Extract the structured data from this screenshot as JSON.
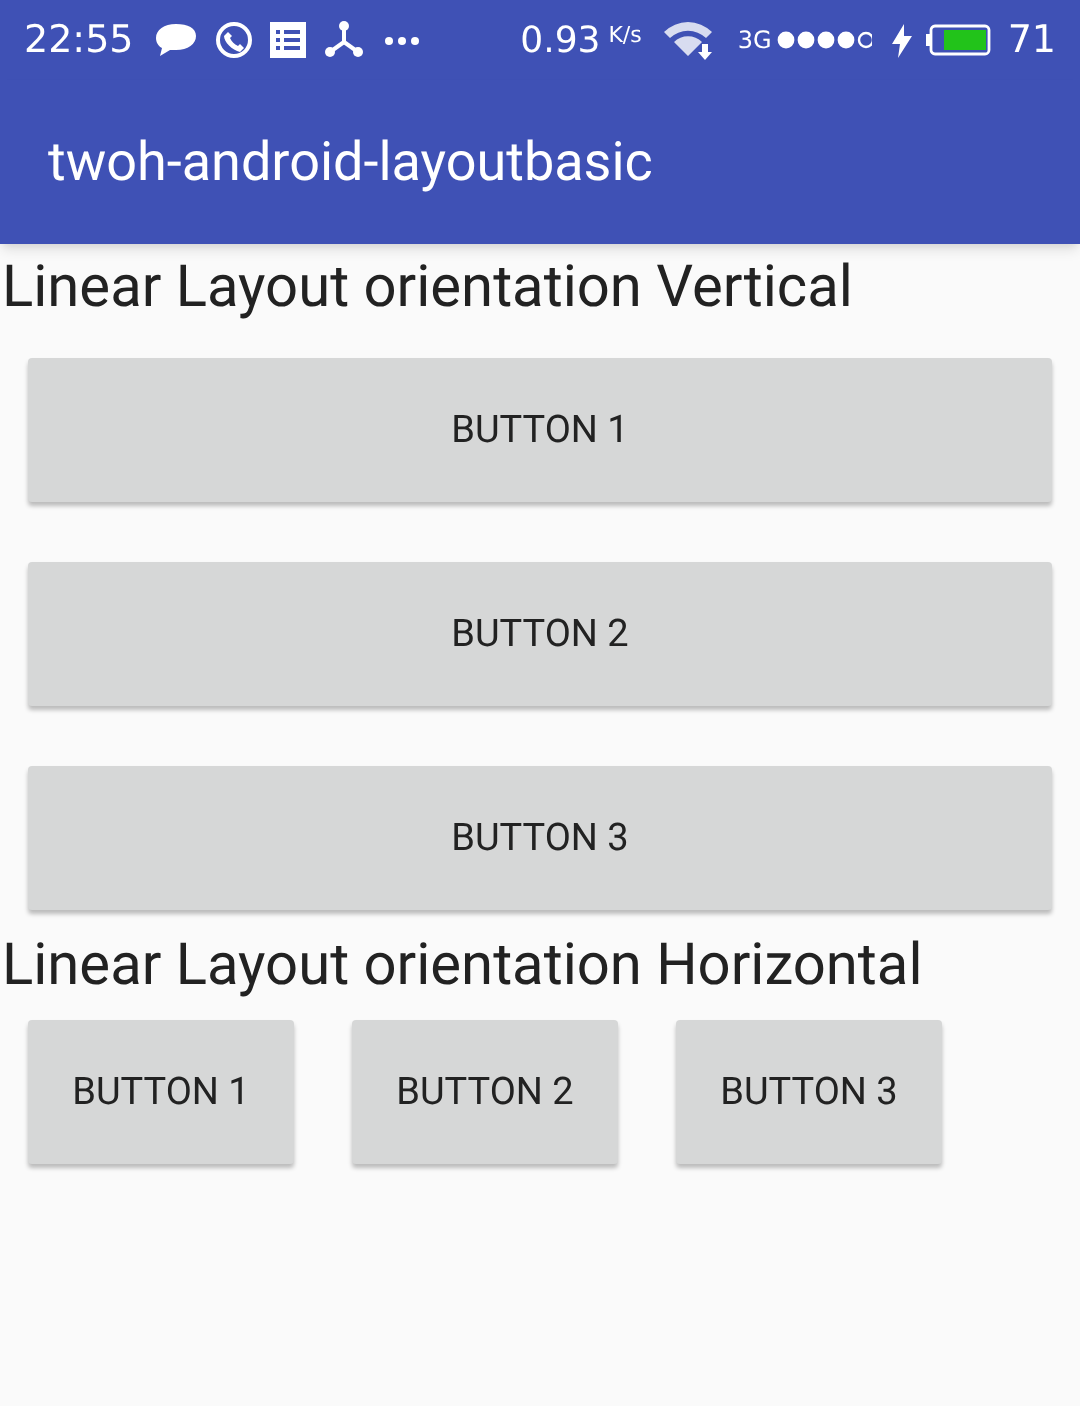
{
  "status_bar": {
    "time": "22:55",
    "speed": "0.93",
    "speed_unit": "K/s",
    "network": "3G",
    "battery": "71"
  },
  "app_bar": {
    "title": "twoh-android-layoutbasic"
  },
  "sections": [
    {
      "heading": "Linear Layout orientation Vertical",
      "kind": "column",
      "buttons": [
        "BUTTON 1",
        "BUTTON 2",
        "BUTTON 3"
      ]
    },
    {
      "heading": "Linear Layout orientation Horizontal",
      "kind": "row",
      "buttons": [
        "BUTTON 1",
        "BUTTON 2",
        "BUTTON 3"
      ]
    }
  ]
}
